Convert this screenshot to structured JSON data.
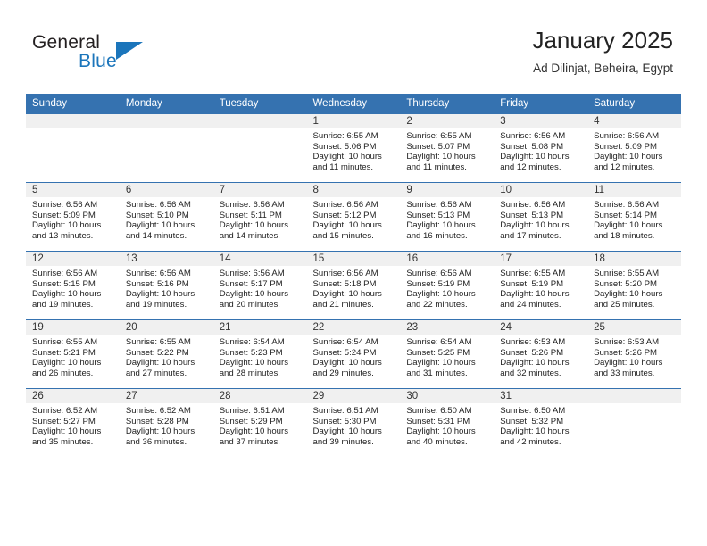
{
  "brand": {
    "name_part1": "General",
    "name_part2": "Blue",
    "accent_color": "#1b75bb"
  },
  "header": {
    "month_title": "January 2025",
    "location": "Ad Dilinjat, Beheira, Egypt"
  },
  "theme": {
    "header_row_color": "#3572b0",
    "date_band_color": "#f0f0f0",
    "grid_line_color": "#3572b0"
  },
  "weekday_headers": [
    "Sunday",
    "Monday",
    "Tuesday",
    "Wednesday",
    "Thursday",
    "Friday",
    "Saturday"
  ],
  "weeks": [
    [
      {
        "date": "",
        "sunrise": "",
        "sunset": "",
        "daylight_line1": "",
        "daylight_line2": ""
      },
      {
        "date": "",
        "sunrise": "",
        "sunset": "",
        "daylight_line1": "",
        "daylight_line2": ""
      },
      {
        "date": "",
        "sunrise": "",
        "sunset": "",
        "daylight_line1": "",
        "daylight_line2": ""
      },
      {
        "date": "1",
        "sunrise": "Sunrise: 6:55 AM",
        "sunset": "Sunset: 5:06 PM",
        "daylight_line1": "Daylight: 10 hours",
        "daylight_line2": "and 11 minutes."
      },
      {
        "date": "2",
        "sunrise": "Sunrise: 6:55 AM",
        "sunset": "Sunset: 5:07 PM",
        "daylight_line1": "Daylight: 10 hours",
        "daylight_line2": "and 11 minutes."
      },
      {
        "date": "3",
        "sunrise": "Sunrise: 6:56 AM",
        "sunset": "Sunset: 5:08 PM",
        "daylight_line1": "Daylight: 10 hours",
        "daylight_line2": "and 12 minutes."
      },
      {
        "date": "4",
        "sunrise": "Sunrise: 6:56 AM",
        "sunset": "Sunset: 5:09 PM",
        "daylight_line1": "Daylight: 10 hours",
        "daylight_line2": "and 12 minutes."
      }
    ],
    [
      {
        "date": "5",
        "sunrise": "Sunrise: 6:56 AM",
        "sunset": "Sunset: 5:09 PM",
        "daylight_line1": "Daylight: 10 hours",
        "daylight_line2": "and 13 minutes."
      },
      {
        "date": "6",
        "sunrise": "Sunrise: 6:56 AM",
        "sunset": "Sunset: 5:10 PM",
        "daylight_line1": "Daylight: 10 hours",
        "daylight_line2": "and 14 minutes."
      },
      {
        "date": "7",
        "sunrise": "Sunrise: 6:56 AM",
        "sunset": "Sunset: 5:11 PM",
        "daylight_line1": "Daylight: 10 hours",
        "daylight_line2": "and 14 minutes."
      },
      {
        "date": "8",
        "sunrise": "Sunrise: 6:56 AM",
        "sunset": "Sunset: 5:12 PM",
        "daylight_line1": "Daylight: 10 hours",
        "daylight_line2": "and 15 minutes."
      },
      {
        "date": "9",
        "sunrise": "Sunrise: 6:56 AM",
        "sunset": "Sunset: 5:13 PM",
        "daylight_line1": "Daylight: 10 hours",
        "daylight_line2": "and 16 minutes."
      },
      {
        "date": "10",
        "sunrise": "Sunrise: 6:56 AM",
        "sunset": "Sunset: 5:13 PM",
        "daylight_line1": "Daylight: 10 hours",
        "daylight_line2": "and 17 minutes."
      },
      {
        "date": "11",
        "sunrise": "Sunrise: 6:56 AM",
        "sunset": "Sunset: 5:14 PM",
        "daylight_line1": "Daylight: 10 hours",
        "daylight_line2": "and 18 minutes."
      }
    ],
    [
      {
        "date": "12",
        "sunrise": "Sunrise: 6:56 AM",
        "sunset": "Sunset: 5:15 PM",
        "daylight_line1": "Daylight: 10 hours",
        "daylight_line2": "and 19 minutes."
      },
      {
        "date": "13",
        "sunrise": "Sunrise: 6:56 AM",
        "sunset": "Sunset: 5:16 PM",
        "daylight_line1": "Daylight: 10 hours",
        "daylight_line2": "and 19 minutes."
      },
      {
        "date": "14",
        "sunrise": "Sunrise: 6:56 AM",
        "sunset": "Sunset: 5:17 PM",
        "daylight_line1": "Daylight: 10 hours",
        "daylight_line2": "and 20 minutes."
      },
      {
        "date": "15",
        "sunrise": "Sunrise: 6:56 AM",
        "sunset": "Sunset: 5:18 PM",
        "daylight_line1": "Daylight: 10 hours",
        "daylight_line2": "and 21 minutes."
      },
      {
        "date": "16",
        "sunrise": "Sunrise: 6:56 AM",
        "sunset": "Sunset: 5:19 PM",
        "daylight_line1": "Daylight: 10 hours",
        "daylight_line2": "and 22 minutes."
      },
      {
        "date": "17",
        "sunrise": "Sunrise: 6:55 AM",
        "sunset": "Sunset: 5:19 PM",
        "daylight_line1": "Daylight: 10 hours",
        "daylight_line2": "and 24 minutes."
      },
      {
        "date": "18",
        "sunrise": "Sunrise: 6:55 AM",
        "sunset": "Sunset: 5:20 PM",
        "daylight_line1": "Daylight: 10 hours",
        "daylight_line2": "and 25 minutes."
      }
    ],
    [
      {
        "date": "19",
        "sunrise": "Sunrise: 6:55 AM",
        "sunset": "Sunset: 5:21 PM",
        "daylight_line1": "Daylight: 10 hours",
        "daylight_line2": "and 26 minutes."
      },
      {
        "date": "20",
        "sunrise": "Sunrise: 6:55 AM",
        "sunset": "Sunset: 5:22 PM",
        "daylight_line1": "Daylight: 10 hours",
        "daylight_line2": "and 27 minutes."
      },
      {
        "date": "21",
        "sunrise": "Sunrise: 6:54 AM",
        "sunset": "Sunset: 5:23 PM",
        "daylight_line1": "Daylight: 10 hours",
        "daylight_line2": "and 28 minutes."
      },
      {
        "date": "22",
        "sunrise": "Sunrise: 6:54 AM",
        "sunset": "Sunset: 5:24 PM",
        "daylight_line1": "Daylight: 10 hours",
        "daylight_line2": "and 29 minutes."
      },
      {
        "date": "23",
        "sunrise": "Sunrise: 6:54 AM",
        "sunset": "Sunset: 5:25 PM",
        "daylight_line1": "Daylight: 10 hours",
        "daylight_line2": "and 31 minutes."
      },
      {
        "date": "24",
        "sunrise": "Sunrise: 6:53 AM",
        "sunset": "Sunset: 5:26 PM",
        "daylight_line1": "Daylight: 10 hours",
        "daylight_line2": "and 32 minutes."
      },
      {
        "date": "25",
        "sunrise": "Sunrise: 6:53 AM",
        "sunset": "Sunset: 5:26 PM",
        "daylight_line1": "Daylight: 10 hours",
        "daylight_line2": "and 33 minutes."
      }
    ],
    [
      {
        "date": "26",
        "sunrise": "Sunrise: 6:52 AM",
        "sunset": "Sunset: 5:27 PM",
        "daylight_line1": "Daylight: 10 hours",
        "daylight_line2": "and 35 minutes."
      },
      {
        "date": "27",
        "sunrise": "Sunrise: 6:52 AM",
        "sunset": "Sunset: 5:28 PM",
        "daylight_line1": "Daylight: 10 hours",
        "daylight_line2": "and 36 minutes."
      },
      {
        "date": "28",
        "sunrise": "Sunrise: 6:51 AM",
        "sunset": "Sunset: 5:29 PM",
        "daylight_line1": "Daylight: 10 hours",
        "daylight_line2": "and 37 minutes."
      },
      {
        "date": "29",
        "sunrise": "Sunrise: 6:51 AM",
        "sunset": "Sunset: 5:30 PM",
        "daylight_line1": "Daylight: 10 hours",
        "daylight_line2": "and 39 minutes."
      },
      {
        "date": "30",
        "sunrise": "Sunrise: 6:50 AM",
        "sunset": "Sunset: 5:31 PM",
        "daylight_line1": "Daylight: 10 hours",
        "daylight_line2": "and 40 minutes."
      },
      {
        "date": "31",
        "sunrise": "Sunrise: 6:50 AM",
        "sunset": "Sunset: 5:32 PM",
        "daylight_line1": "Daylight: 10 hours",
        "daylight_line2": "and 42 minutes."
      },
      {
        "date": "",
        "sunrise": "",
        "sunset": "",
        "daylight_line1": "",
        "daylight_line2": ""
      }
    ]
  ]
}
